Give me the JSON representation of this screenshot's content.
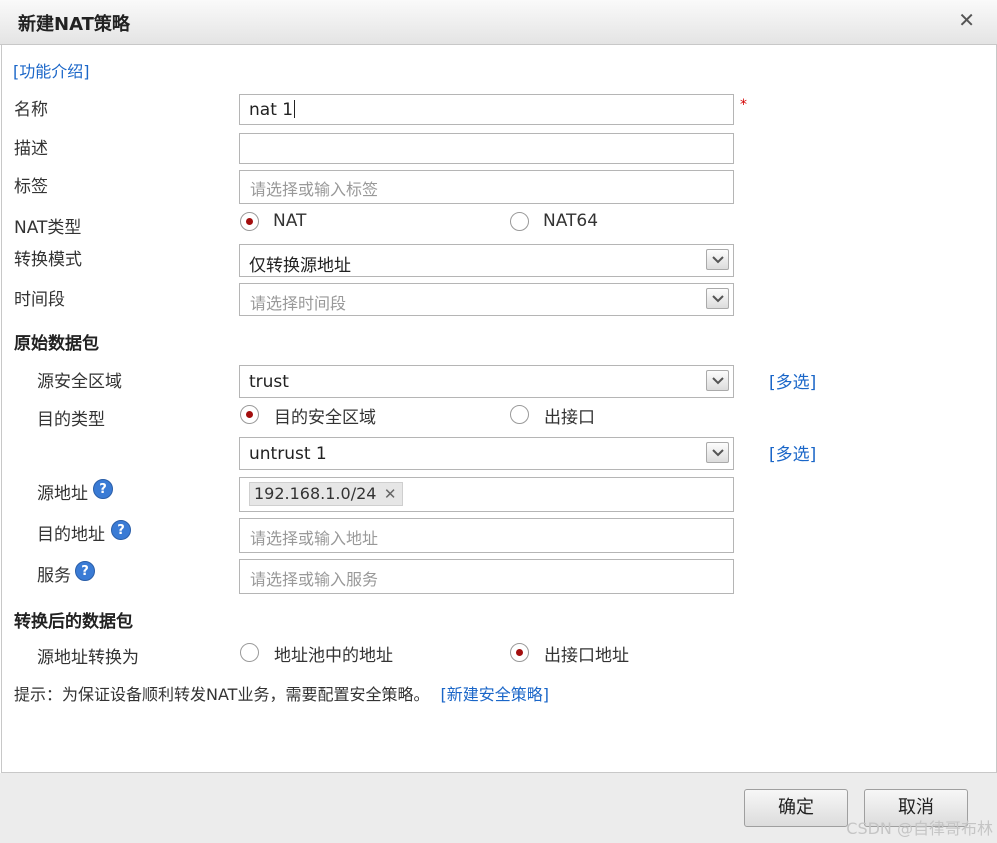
{
  "dialog": {
    "title": "新建NAT策略",
    "close_glyph": "✕",
    "feature_link": "[功能介绍]"
  },
  "form": {
    "name_label": "名称",
    "name_value": "nat 1",
    "required_mark": "*",
    "desc_label": "描述",
    "desc_value": "",
    "tag_label": "标签",
    "tag_placeholder": "请选择或输入标签",
    "nat_type_label": "NAT类型",
    "nat_type_options": [
      "NAT",
      "NAT64"
    ],
    "nat_type_selected": "NAT",
    "mode_label": "转换模式",
    "mode_value": "仅转换源地址",
    "time_label": "时间段",
    "time_placeholder": "请选择时间段"
  },
  "original_packet": {
    "section_title": "原始数据包",
    "src_zone_label": "源安全区域",
    "src_zone_value": "trust",
    "multi_select_link": "[多选]",
    "dst_type_label": "目的类型",
    "dst_type_options": [
      "目的安全区域",
      "出接口"
    ],
    "dst_type_selected": "目的安全区域",
    "dst_zone_value": "untrust 1",
    "src_addr_label": "源地址",
    "src_addr_tag": "192.168.1.0/24",
    "tag_remove_glyph": "✕",
    "dst_addr_label": "目的地址",
    "dst_addr_placeholder": "请选择或输入地址",
    "service_label": "服务",
    "service_placeholder": "请选择或输入服务",
    "help_glyph": "?"
  },
  "translated_packet": {
    "section_title": "转换后的数据包",
    "src_trans_label": "源地址转换为",
    "src_trans_options": [
      "地址池中的地址",
      "出接口地址"
    ],
    "src_trans_selected": "出接口地址"
  },
  "hint": {
    "text": "提示：为保证设备顺利转发NAT业务，需要配置安全策略。",
    "link": "[新建安全策略]"
  },
  "footer": {
    "ok_label": "确定",
    "cancel_label": "取消",
    "watermark": "CSDN @自律哥布林"
  },
  "colors": {
    "link": "#1a66c8",
    "radio_selected": "#a30e0e",
    "required": "#d40000",
    "help_icon": "#3a7bd5"
  },
  "icons": {
    "dropdown": "chevron-down-icon",
    "help": "help-icon",
    "close": "close-icon"
  }
}
